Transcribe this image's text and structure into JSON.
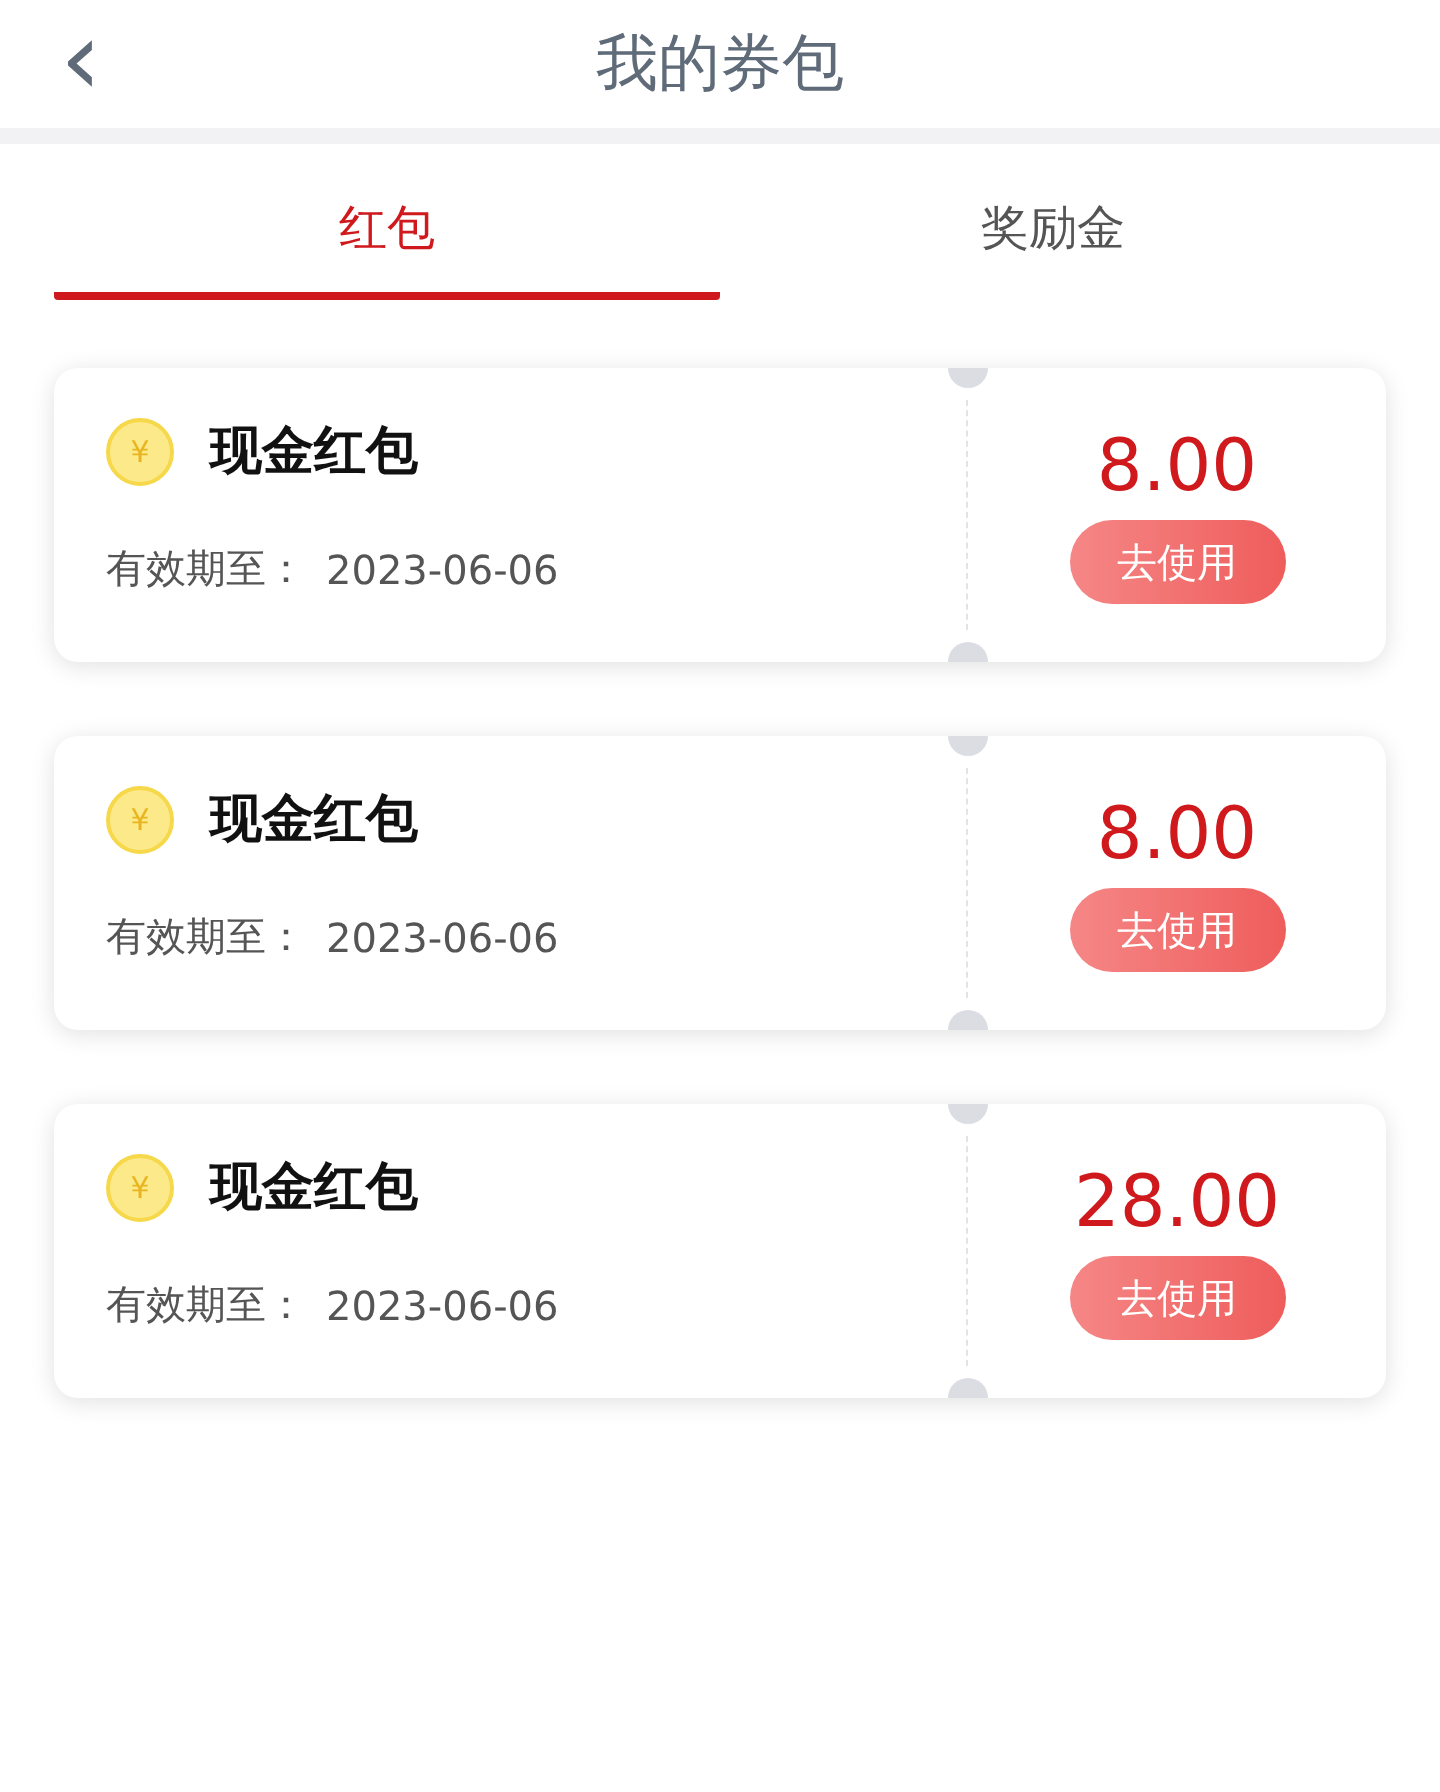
{
  "header": {
    "back_icon": "‹",
    "title": "我的券包"
  },
  "tabs": [
    {
      "label": "红包",
      "selected": true
    },
    {
      "label": "奖励金",
      "selected": false
    }
  ],
  "coupons": [
    {
      "coin_symbol": "¥",
      "name": "现金红包",
      "validity_label": "有效期至：",
      "expiry_date": "2023-06-06",
      "amount": "8.00",
      "action": "去使用"
    },
    {
      "coin_symbol": "¥",
      "name": "现金红包",
      "validity_label": "有效期至：",
      "expiry_date": "2023-06-06",
      "amount": "8.00",
      "action": "去使用"
    },
    {
      "coin_symbol": "¥",
      "name": "现金红包",
      "validity_label": "有效期至：",
      "expiry_date": "2023-06-06",
      "amount": "28.00",
      "action": "去使用"
    }
  ]
}
